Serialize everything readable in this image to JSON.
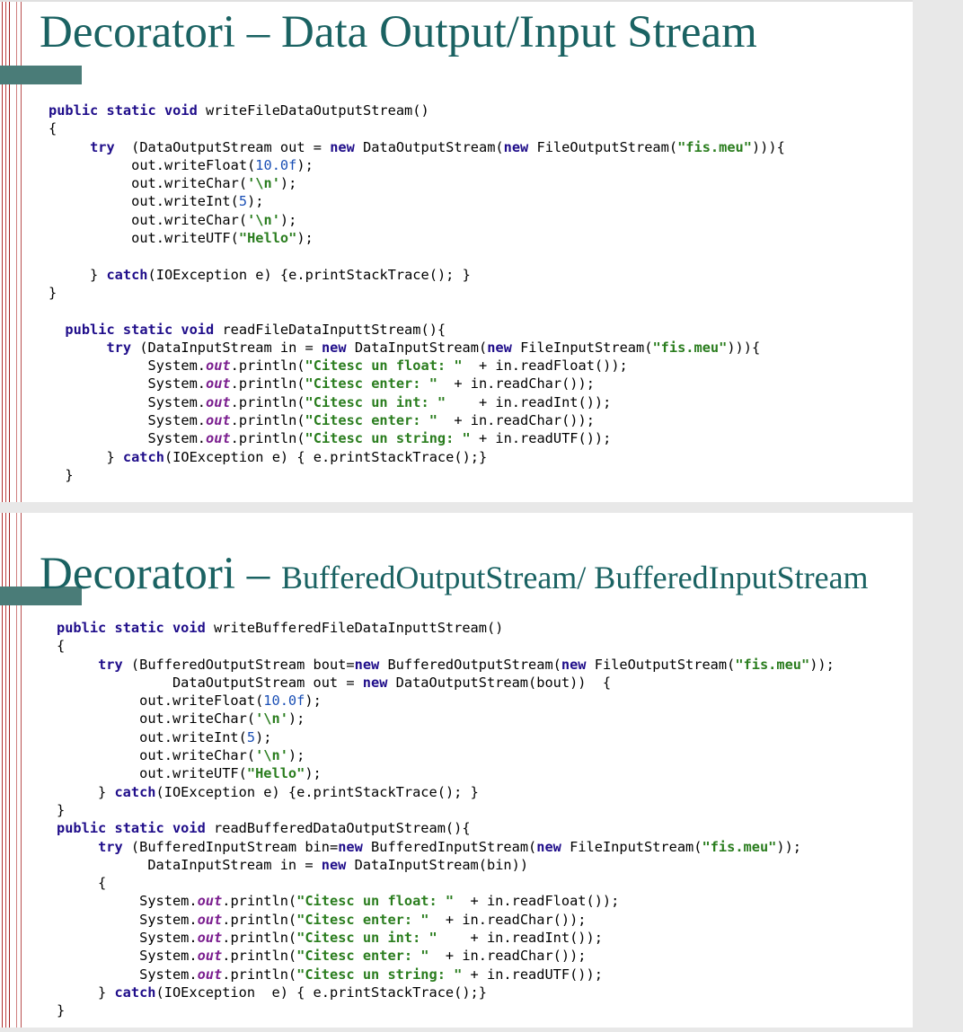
{
  "slides": [
    {
      "title": "Decoratori – Data Output/Input Stream",
      "code": [
        "public static void writeFileDataOutputStream()",
        "{",
        "     try  (DataOutputStream out = new DataOutputStream(new FileOutputStream(\"fis.meu\"))){",
        "          out.writeFloat(10.0f);",
        "          out.writeChar('\\n');",
        "          out.writeInt(5);",
        "          out.writeChar('\\n');",
        "          out.writeUTF(\"Hello\");",
        "",
        "     } catch(IOException e) {e.printStackTrace(); }",
        "}",
        "",
        "  public static void readFileDataInputtStream(){",
        "       try (DataInputStream in = new DataInputStream(new FileInputStream(\"fis.meu\"))){",
        "            System.out.println(\"Citesc un float: \"  + in.readFloat());",
        "            System.out.println(\"Citesc enter: \"  + in.readChar());",
        "            System.out.println(\"Citesc un int: \"    + in.readInt());",
        "            System.out.println(\"Citesc enter: \"  + in.readChar());",
        "            System.out.println(\"Citesc un string: \" + in.readUTF());",
        "       } catch(IOException e) { e.printStackTrace();}",
        "  }"
      ]
    },
    {
      "title_main": "Decoratori",
      "title_dash": " – ",
      "title_sub": "BufferedOutputStream/ BufferedInputStream",
      "code": [
        "public static void writeBufferedFileDataInputtStream()",
        "{",
        "     try (BufferedOutputStream bout=new BufferedOutputStream(new FileOutputStream(\"fis.meu\"));",
        "              DataOutputStream out = new DataOutputStream(bout))  {",
        "          out.writeFloat(10.0f);",
        "          out.writeChar('\\n');",
        "          out.writeInt(5);",
        "          out.writeChar('\\n');",
        "          out.writeUTF(\"Hello\");",
        "     } catch(IOException e) {e.printStackTrace(); }",
        "}",
        "public static void readBufferedDataOutputStream(){",
        "     try (BufferedInputStream bin=new BufferedInputStream(new FileInputStream(\"fis.meu\"));",
        "           DataInputStream in = new DataInputStream(bin))",
        "     {",
        "          System.out.println(\"Citesc un float: \"  + in.readFloat());",
        "          System.out.println(\"Citesc enter: \"  + in.readChar());",
        "          System.out.println(\"Citesc un int: \"    + in.readInt());",
        "          System.out.println(\"Citesc enter: \"  + in.readChar());",
        "          System.out.println(\"Citesc un string: \" + in.readUTF());",
        "     } catch(IOException  e) { e.printStackTrace();}",
        "}"
      ]
    }
  ]
}
